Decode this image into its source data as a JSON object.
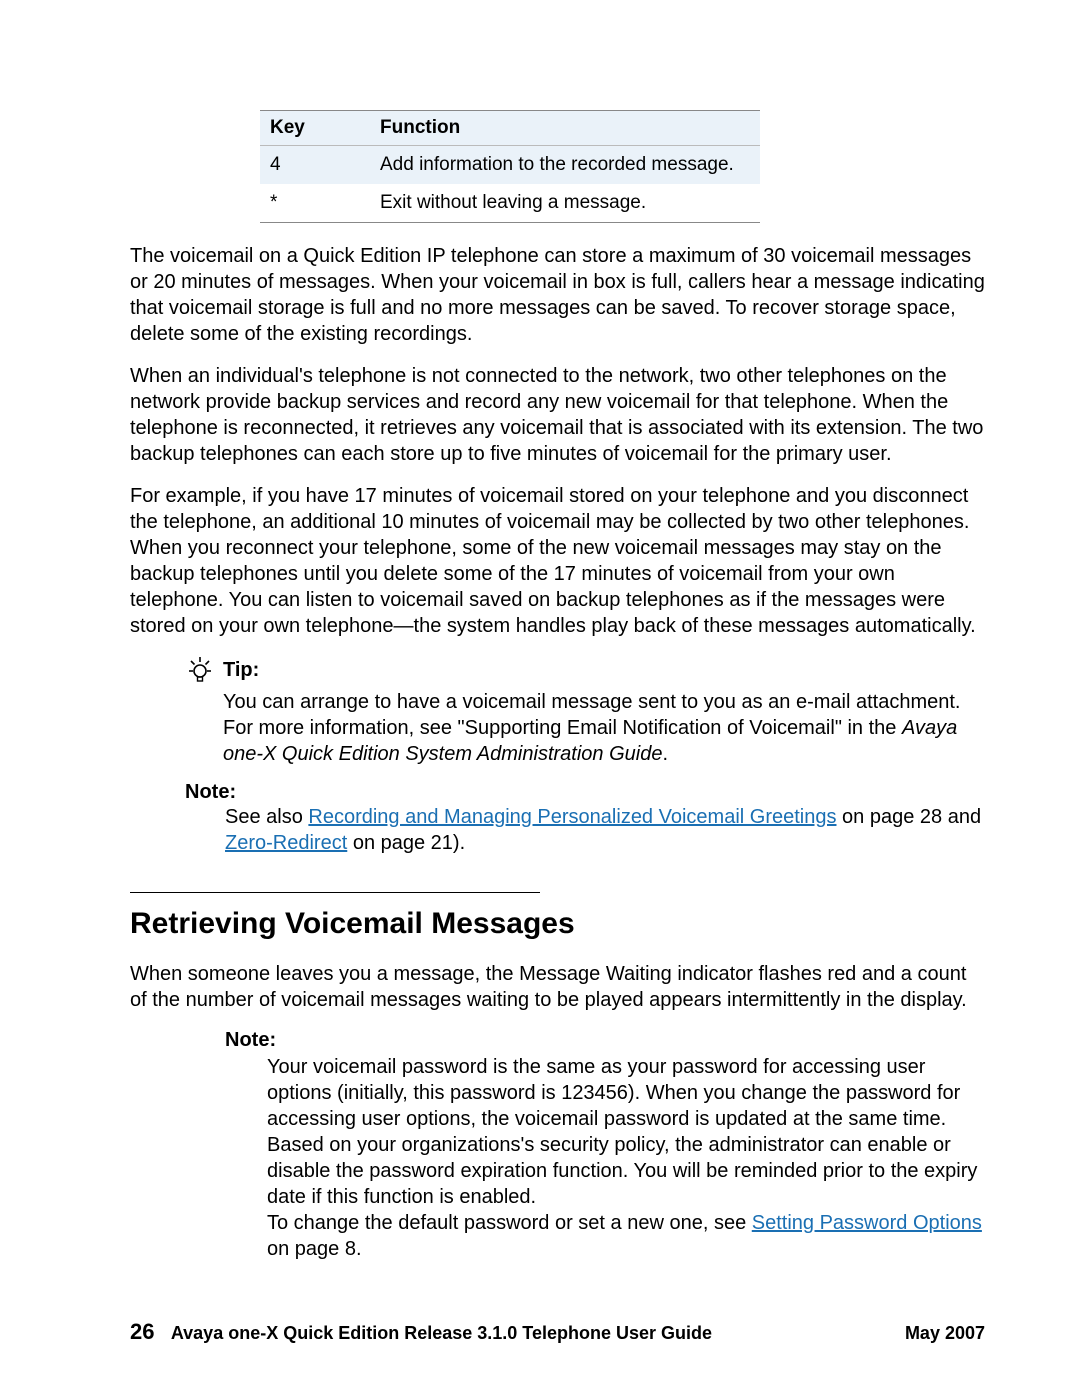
{
  "table": {
    "headers": {
      "key": "Key",
      "function": "Function"
    },
    "rows": [
      {
        "key": "4",
        "function": "Add information to the recorded message."
      },
      {
        "key": "*",
        "function": "Exit without leaving a message."
      }
    ]
  },
  "paragraph1": "The voicemail on a Quick Edition IP telephone can store a maximum of 30 voicemail messages or 20 minutes of messages. When your voicemail in box is full, callers hear a message indicating that voicemail storage is full and no more messages can be saved. To recover storage space, delete some of the existing recordings.",
  "paragraph2": "When an individual's telephone is not connected to the network, two other telephones on the network provide backup services and record any new voicemail for that telephone. When the telephone is reconnected, it retrieves any voicemail that is associated with its extension. The two backup telephones can each store up to five minutes of voicemail for the primary user.",
  "paragraph3": "For example, if you have 17 minutes of voicemail stored on your telephone and you disconnect the telephone, an additional 10 minutes of voicemail may be collected by two other telephones. When you reconnect your telephone, some of the new voicemail messages may stay on the backup telephones until you delete some of the 17 minutes of voicemail from your own telephone. You can listen to voicemail saved on backup telephones as if the messages were stored on your own telephone—the system handles play back of these messages automatically.",
  "tip": {
    "label": "Tip:",
    "body_pre": "You can arrange to have a voicemail message sent to you as an e-mail attachment. For more information, see \"Supporting Email Notification of Voicemail\" in the ",
    "body_italic": "Avaya one-X Quick Edition System Administration Guide",
    "body_post": "."
  },
  "note1": {
    "label": "Note:",
    "pre": "See also ",
    "link1": "Recording and Managing Personalized Voicemail Greetings",
    "mid1": " on page 28 and ",
    "link2": "Zero-Redirect",
    "mid2": " on page 21)."
  },
  "section_heading": "Retrieving Voicemail Messages",
  "paragraph4": "When someone leaves you a message, the Message Waiting indicator flashes red and a count of the number of voicemail messages waiting to be played appears intermittently in the display.",
  "note2": {
    "label": "Note:",
    "body1": "Your voicemail password is the same as your password for accessing user options (initially, this password is 123456). When you change the password for accessing user options, the voicemail password is updated at the same time. Based on your organizations's security policy, the administrator can enable or disable the password expiration function. You will be reminded prior to the expiry date if this function is enabled.",
    "body2_pre": "To change the default password or set a new one, see ",
    "body2_link": "Setting Password Options",
    "body2_post": " on page 8."
  },
  "footer": {
    "page_number": "26",
    "title": "Avaya one-X Quick Edition Release 3.1.0 Telephone User Guide",
    "date": "May 2007"
  }
}
